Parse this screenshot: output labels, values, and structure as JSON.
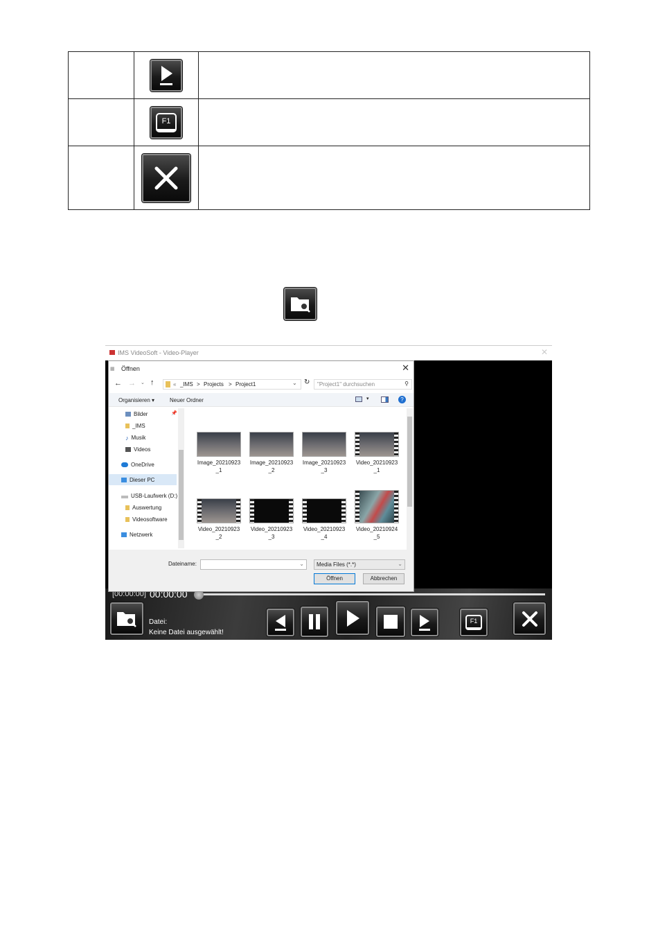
{
  "table": {
    "rows": [
      {
        "icon": "play-icon"
      },
      {
        "icon": "f1-help-icon",
        "key_label": "F1"
      },
      {
        "icon": "close-icon"
      }
    ]
  },
  "inline_icon": "folder-search-icon",
  "player": {
    "window_title": "IMS VideoSoft - Video-Player",
    "time_bracket": "[00:00:00]",
    "time_main": "00:00:00",
    "file_label": "Datei:",
    "file_status": "Keine Datei ausgewählt!",
    "f1_label": "F1"
  },
  "dialog": {
    "title": "Öffnen",
    "breadcrumb": [
      "«",
      "_IMS",
      ">",
      "Projects",
      ">",
      "Project1"
    ],
    "search_placeholder": "\"Project1\" durchsuchen",
    "organize": "Organisieren ▾",
    "new_folder": "Neuer Ordner",
    "nav": [
      "Bilder",
      "_IMS",
      "Musik",
      "Videos",
      "OneDrive",
      "Dieser PC",
      "USB-Laufwerk (D:)",
      "Auswertung",
      "Videosoftware",
      "Netzwerk"
    ],
    "files": [
      {
        "name1": "Image_20210923",
        "name2": "_1"
      },
      {
        "name1": "Image_20210923",
        "name2": "_2"
      },
      {
        "name1": "Image_20210923",
        "name2": "_3"
      },
      {
        "name1": "Video_20210923",
        "name2": "_1"
      },
      {
        "name1": "Video_20210923",
        "name2": "_2"
      },
      {
        "name1": "Video_20210923",
        "name2": "_3"
      },
      {
        "name1": "Video_20210923",
        "name2": "_4"
      },
      {
        "name1": "Video_20210924",
        "name2": "_5"
      }
    ],
    "filename_label": "Dateiname:",
    "filter": "Media Files (*.*)",
    "open_button": "Öffnen",
    "cancel_button": "Abbrechen"
  }
}
